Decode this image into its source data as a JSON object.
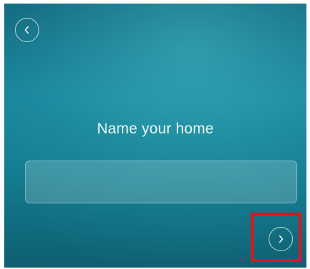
{
  "screen": {
    "title": "Name your home",
    "home_name_input": {
      "value": "",
      "placeholder": ""
    },
    "back_button": {
      "icon": "chevron-left-icon"
    },
    "next_button": {
      "icon": "chevron-right-icon",
      "highlighted": true
    }
  },
  "colors": {
    "background_top": "#0f5f75",
    "background_mid": "#178399",
    "highlight": "#e0141b"
  }
}
